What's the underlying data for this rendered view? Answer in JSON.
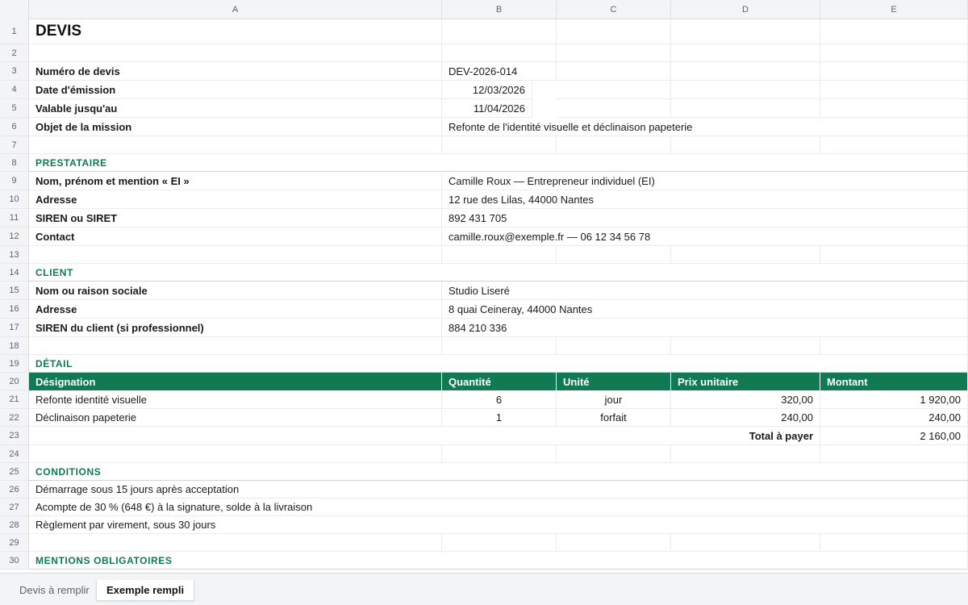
{
  "colors": {
    "accent": "#117a52",
    "section_text": "#0e7a50"
  },
  "columns": [
    "A",
    "B",
    "C",
    "D",
    "E"
  ],
  "rows": {
    "title": "DEVIS",
    "numero_label": "Numéro de devis",
    "numero_value": "DEV-2026-014",
    "date_label": "Date d'émission",
    "date_value": "12/03/2026",
    "valable_label": "Valable jusqu'au",
    "valable_value": "11/04/2026",
    "objet_label": "Objet de la mission",
    "objet_value": "Refonte de l'identité visuelle et déclinaison papeterie",
    "prestataire_section": "PRESTATAIRE",
    "nom_label": "Nom, prénom et mention « EI »",
    "nom_value": "Camille Roux — Entrepreneur individuel (EI)",
    "adresse_label": "Adresse",
    "adresse_value": "12 rue des Lilas, 44000 Nantes",
    "siren_label": "SIREN ou SIRET",
    "siren_value": "892 431 705",
    "contact_label": "Contact",
    "contact_value": "camille.roux@exemple.fr — 06 12 34 56 78",
    "client_section": "CLIENT",
    "client_nom_label": "Nom ou raison sociale",
    "client_nom_value": "Studio Liseré",
    "client_adresse_label": "Adresse",
    "client_adresse_value": "8 quai Ceineray, 44000 Nantes",
    "client_siren_label": "SIREN du client (si professionnel)",
    "client_siren_value": "884 210 336",
    "detail_section": "DÉTAIL",
    "table_headers": [
      "Désignation",
      "Quantité",
      "Unité",
      "Prix unitaire",
      "Montant"
    ],
    "items": [
      [
        "Refonte identité visuelle",
        "6",
        "jour",
        "320,00",
        "1 920,00"
      ],
      [
        "Déclinaison papeterie",
        "1",
        "forfait",
        "240,00",
        "240,00"
      ]
    ],
    "total_label": "Total à payer",
    "total_value": "2 160,00",
    "conditions_section": "CONDITIONS",
    "conditions": [
      "Démarrage sous 15 jours après acceptation",
      "Acompte de 30 % (648 €) à la signature, solde à la livraison",
      "Règlement par virement, sous 30 jours"
    ],
    "mentions_section": "MENTIONS OBLIGATOIRES"
  },
  "row_numbers": [
    "1",
    "2",
    "3",
    "4",
    "5",
    "6",
    "7",
    "8",
    "9",
    "10",
    "11",
    "12",
    "13",
    "14",
    "15",
    "16",
    "17",
    "18",
    "19",
    "20",
    "21",
    "22",
    "23",
    "24",
    "25",
    "26",
    "27",
    "28",
    "29",
    "30"
  ],
  "tabs": [
    "Devis à remplir",
    "Exemple rempli"
  ],
  "active_tab": "Exemple rempli"
}
